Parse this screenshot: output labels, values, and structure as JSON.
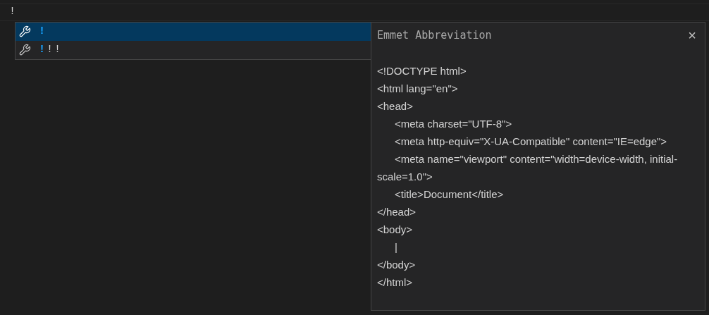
{
  "editor": {
    "line_text": "!"
  },
  "suggestions": [
    {
      "match": "!",
      "selected": true
    },
    {
      "match": "!",
      "rest": "!!",
      "selected": false
    }
  ],
  "details": {
    "title": "Emmet Abbreviation",
    "close": "×",
    "code": "<!DOCTYPE html>\n<html lang=\"en\">\n<head>\n\t<meta charset=\"UTF-8\">\n\t<meta http-equiv=\"X-UA-Compatible\" content=\"IE=edge\">\n\t<meta name=\"viewport\" content=\"width=device-width, initial-scale=1.0\">\n\t<title>Document</title>\n</head>\n<body>\n\t|\n</body>\n</html>"
  }
}
